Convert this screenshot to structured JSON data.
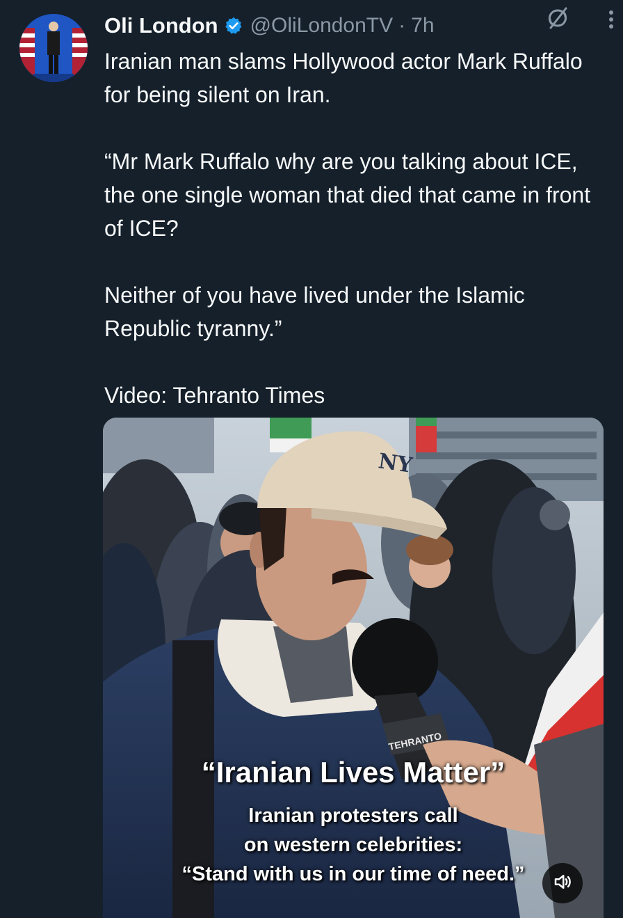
{
  "author": {
    "name": "Oli London",
    "handle": "@OliLondonTV",
    "separator": "·",
    "time": "7h",
    "verified_color": "#1d9bf0"
  },
  "post": {
    "paragraphs": [
      "Iranian man slams Hollywood actor Mark Ruffalo for being silent on Iran.",
      "“Mr Mark Ruffalo why are you talking about ICE, the one single woman that died that came in front of ICE?",
      "Neither of you have lived under the Islamic Republic tyranny.”",
      "Video: Tehranto Times"
    ]
  },
  "media": {
    "caption_title": "“Iranian Lives Matter”",
    "caption_lines": [
      "Iranian protesters call",
      "on western celebrities:",
      "“Stand with us in our time of need.”"
    ],
    "cap_logo": "NY",
    "mic_label": "TEHRANTO",
    "mute_icon": "speaker-volume-icon"
  },
  "icons": {
    "grok": "grok-icon",
    "more": "more-vertical-icon",
    "verified": "verified-badge-icon"
  },
  "colors": {
    "background": "#15202b",
    "text": "#f7f9f9",
    "secondary": "#8b98a5"
  }
}
